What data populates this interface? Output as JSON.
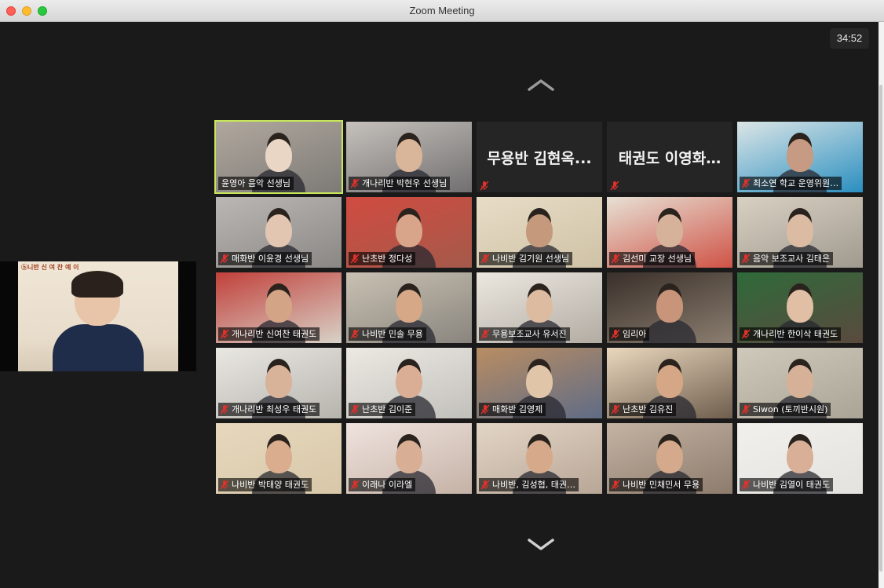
{
  "window": {
    "title": "Zoom Meeting"
  },
  "meeting": {
    "timer": "34:52"
  },
  "pinned": {
    "sign": "ⓑ니반 신 여 찬 예 이"
  },
  "colors": {
    "active_speaker": "#c8e65a",
    "muted_mic": "#e0312b",
    "background": "#1a1a1a"
  },
  "icons": {
    "scroll_up": "chevron-up-icon",
    "scroll_down": "chevron-down-icon",
    "mic": "mic-muted-icon"
  },
  "participants": [
    {
      "name": "윤영아 음악 선생님",
      "muted": false,
      "active": true,
      "video": true
    },
    {
      "name": "개나리반 박현우 선생님",
      "muted": true,
      "video": true
    },
    {
      "name": "무용반 김현옥...",
      "muted": true,
      "video": false
    },
    {
      "name": "태권도 이영화…",
      "muted": true,
      "video": false
    },
    {
      "name": "최소연 학교 운영위원…",
      "muted": true,
      "video": true
    },
    {
      "name": "매화반 이윤경 선생님",
      "muted": true,
      "video": true
    },
    {
      "name": "난초반 정다성",
      "muted": true,
      "video": true
    },
    {
      "name": "나비반 김기원 선생님",
      "muted": true,
      "video": true
    },
    {
      "name": "김선미 교장 선생님",
      "muted": true,
      "video": true
    },
    {
      "name": "음악 보조교사 김태은",
      "muted": true,
      "video": true
    },
    {
      "name": "개나리반 신여찬 태권도",
      "muted": true,
      "video": true
    },
    {
      "name": "나비반 민솔 무용",
      "muted": true,
      "video": true
    },
    {
      "name": "무용보조교사 유서진",
      "muted": true,
      "video": true
    },
    {
      "name": "임리아",
      "muted": true,
      "video": true
    },
    {
      "name": "개나리반 한이삭 태권도",
      "muted": true,
      "video": true
    },
    {
      "name": "개나리반 최성우 태권도",
      "muted": true,
      "video": true
    },
    {
      "name": "난초반 김이준",
      "muted": true,
      "video": true
    },
    {
      "name": "매화반 김영제",
      "muted": true,
      "video": true
    },
    {
      "name": "난초반 김유진",
      "muted": true,
      "video": true
    },
    {
      "name": "Siwon (토끼반시원)",
      "muted": true,
      "video": true
    },
    {
      "name": "나비반 박태양 태권도",
      "muted": true,
      "video": true
    },
    {
      "name": "이래나 이라엘",
      "muted": true,
      "video": true
    },
    {
      "name": "나비반, 김성협, 태권…",
      "muted": true,
      "video": true
    },
    {
      "name": "나비반 민채민서 무용",
      "muted": true,
      "video": true
    },
    {
      "name": "나비반 김열이 태권도",
      "muted": true,
      "video": true
    }
  ]
}
